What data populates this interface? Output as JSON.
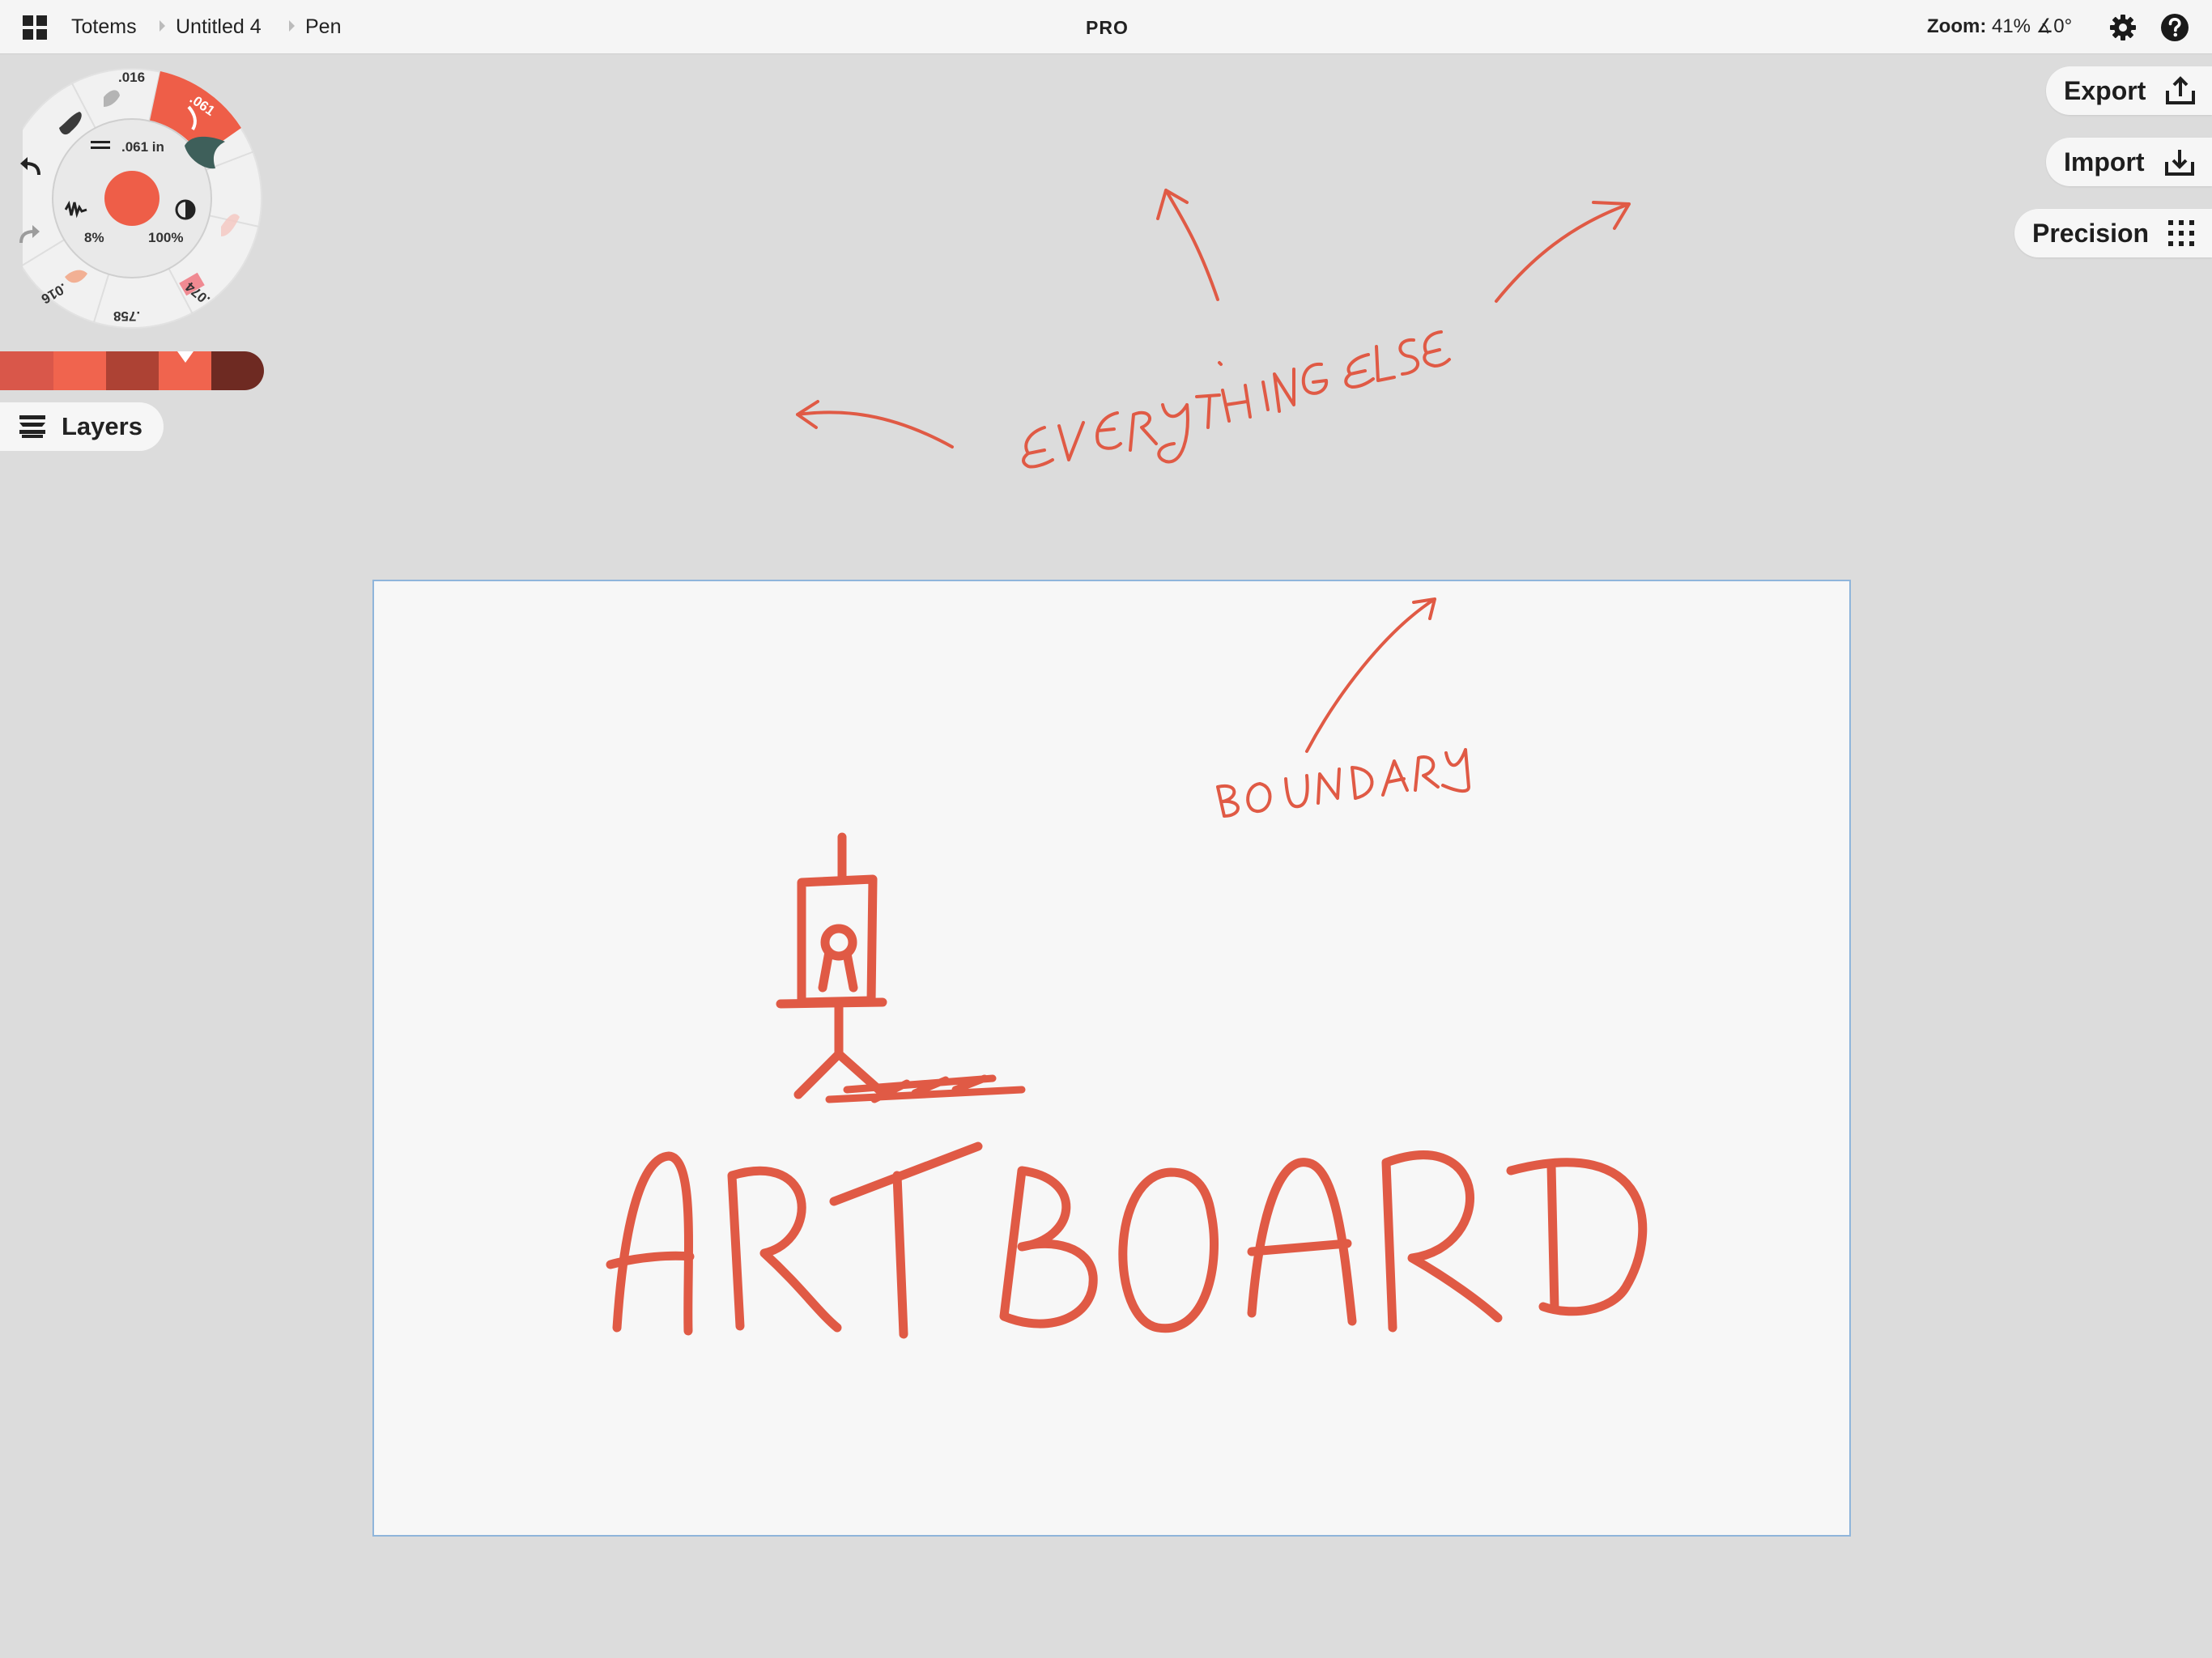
{
  "topbar": {
    "breadcrumb": [
      "Totems",
      "Untitled 4",
      "Pen"
    ],
    "badge": "PRO",
    "zoom_label": "Zoom:",
    "zoom_value": "41%",
    "rotation_value": "∡0°",
    "icons": [
      "grid-icon",
      "gear-icon",
      "help-icon"
    ]
  },
  "actions": {
    "export_label": "Export",
    "import_label": "Import",
    "precision_label": "Precision"
  },
  "brush_wheel": {
    "size_value": ".061 in",
    "smoothing_value": "8%",
    "opacity_value": "100%",
    "presets": [
      ".016",
      ".061",
      ".074",
      ".758",
      ".016"
    ],
    "active_preset": ".061",
    "current_color": "#ee5e48"
  },
  "palette": {
    "swatches": [
      "#d9574a",
      "#f0644e",
      "#ad4234",
      "#f0644e",
      "#6e2a22"
    ]
  },
  "layers": {
    "label": "Layers"
  },
  "canvas": {
    "ink_color": "#e05a45",
    "artboard_border_color": "#8fb5db",
    "handwritten": [
      "EVERYTHING ELSE",
      "BOUNDARY",
      "ARTBOARD"
    ]
  }
}
